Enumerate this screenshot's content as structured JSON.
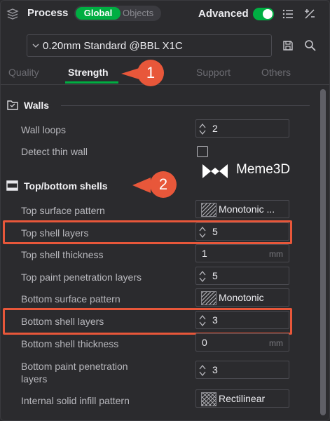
{
  "header": {
    "title": "Process",
    "toggle_global": "Global",
    "toggle_objects": "Objects",
    "advanced_label": "Advanced",
    "advanced_on": true
  },
  "preset": {
    "name": "0.20mm Standard @BBL X1C"
  },
  "tabs": [
    {
      "label": "Quality",
      "active": false
    },
    {
      "label": "Strength",
      "active": true
    },
    {
      "label": "Support",
      "active": false
    },
    {
      "label": "Others",
      "active": false
    }
  ],
  "callouts": [
    "1",
    "2"
  ],
  "sections": {
    "walls": {
      "title": "Walls",
      "rows": {
        "wall_loops": {
          "label": "Wall loops",
          "value": "2"
        },
        "detect_thin_wall": {
          "label": "Detect thin wall",
          "checked": false
        }
      }
    },
    "shells": {
      "title": "Top/bottom shells",
      "rows": {
        "top_surface_pattern": {
          "label": "Top surface pattern",
          "value": "Monotonic ..."
        },
        "top_shell_layers": {
          "label": "Top shell layers",
          "value": "5"
        },
        "top_shell_thickness": {
          "label": "Top shell thickness",
          "value": "1",
          "unit": "mm"
        },
        "top_paint_penetration_layers": {
          "label": "Top paint penetration layers",
          "value": "5"
        },
        "bottom_surface_pattern": {
          "label": "Bottom surface pattern",
          "value": "Monotonic"
        },
        "bottom_shell_layers": {
          "label": "Bottom shell layers",
          "value": "3"
        },
        "bottom_shell_thickness": {
          "label": "Bottom shell thickness",
          "value": "0",
          "unit": "mm"
        },
        "bottom_paint_penetration_layers_1": {
          "label": "Bottom paint penetration"
        },
        "bottom_paint_penetration_layers_2": {
          "label": "layers",
          "value": "3"
        },
        "internal_solid_infill_pattern": {
          "label": "Internal solid infill pattern",
          "value": "Rectilinear"
        }
      }
    }
  },
  "watermark": {
    "text": "Meme3D"
  },
  "colors": {
    "accent": "#00ae42",
    "callout": "#e8573a",
    "background": "#2b2b2e"
  }
}
